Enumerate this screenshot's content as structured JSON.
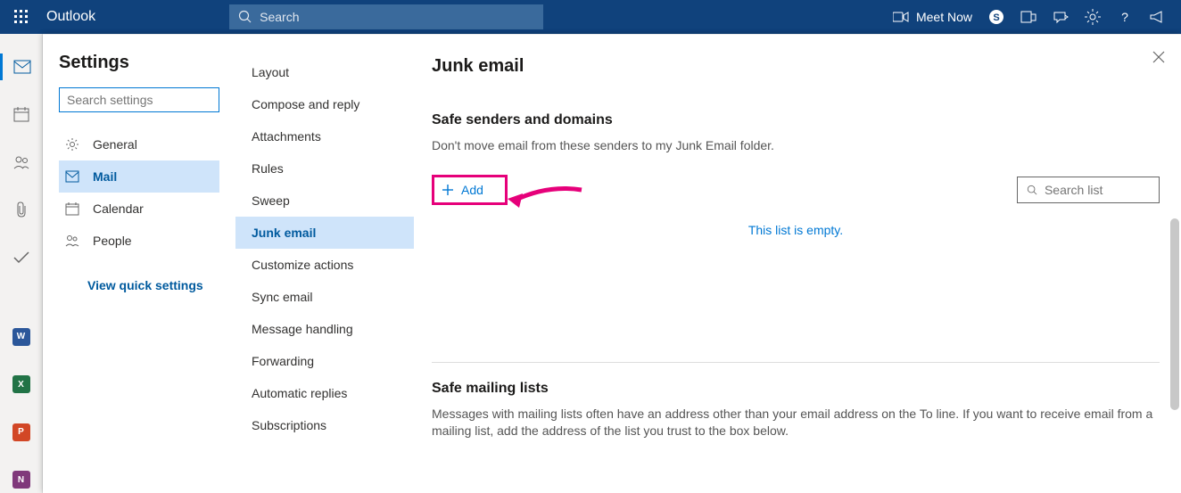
{
  "header": {
    "brand": "Outlook",
    "search_placeholder": "Search",
    "meet_now": "Meet Now"
  },
  "settings": {
    "title": "Settings",
    "search_placeholder": "Search settings",
    "nav": {
      "general": "General",
      "mail": "Mail",
      "calendar": "Calendar",
      "people": "People"
    },
    "view_quick": "View quick settings"
  },
  "mail_submenu": {
    "layout": "Layout",
    "compose": "Compose and reply",
    "attachments": "Attachments",
    "rules": "Rules",
    "sweep": "Sweep",
    "junk": "Junk email",
    "customize": "Customize actions",
    "sync": "Sync email",
    "handling": "Message handling",
    "forwarding": "Forwarding",
    "autoreply": "Automatic replies",
    "subscriptions": "Subscriptions"
  },
  "junk": {
    "page_title": "Junk email",
    "safe_senders_title": "Safe senders and domains",
    "safe_senders_desc": "Don't move email from these senders to my Junk Email folder.",
    "add_label": "Add",
    "search_list_placeholder": "Search list",
    "empty": "This list is empty.",
    "mailing_title": "Safe mailing lists",
    "mailing_desc": "Messages with mailing lists often have an address other than your email address on the To line. If you want to receive email from a mailing list, add the address of the list you trust to the box below."
  },
  "rail_docs": {
    "word": "W",
    "excel": "X",
    "ppt": "P",
    "onenote": "N"
  }
}
